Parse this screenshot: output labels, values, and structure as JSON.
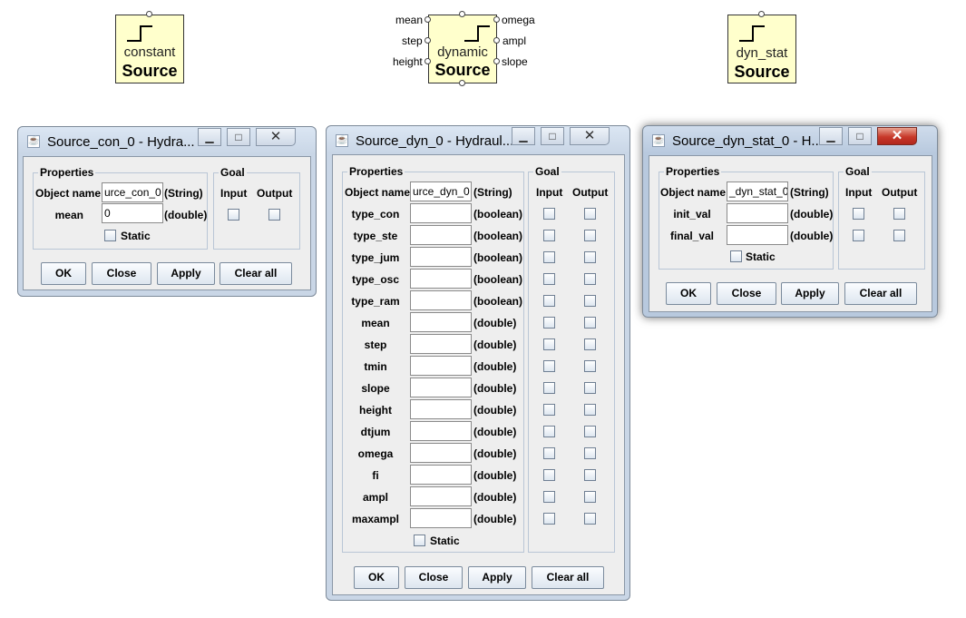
{
  "blocks": {
    "constant": {
      "sub": "constant",
      "main": "Source"
    },
    "dynamic": {
      "sub": "dynamic",
      "main": "Source",
      "ports_left": [
        "mean",
        "step",
        "height"
      ],
      "ports_right": [
        "omega",
        "ampl",
        "slope"
      ]
    },
    "dyn_stat": {
      "sub": "dyn_stat",
      "main": "Source"
    }
  },
  "win_con": {
    "title": "Source_con_0 - Hydra...",
    "properties_legend": "Properties",
    "goal_legend": "Goal",
    "input_header": "Input",
    "output_header": "Output",
    "object_name_label": "Object name",
    "object_name_value": "urce_con_0",
    "object_name_type": "(String)",
    "mean_label": "mean",
    "mean_value": "0",
    "mean_type": "(double)",
    "static_label": "Static",
    "buttons": {
      "ok": "OK",
      "close": "Close",
      "apply": "Apply",
      "clear": "Clear all"
    }
  },
  "win_dyn": {
    "title": "Source_dyn_0 - Hydraul...",
    "properties_legend": "Properties",
    "goal_legend": "Goal",
    "input_header": "Input",
    "output_header": "Output",
    "object_name_label": "Object name",
    "object_name_value": "urce_dyn_0",
    "object_name_type": "(String)",
    "rows": [
      {
        "label": "type_con",
        "type": "(boolean)"
      },
      {
        "label": "type_ste",
        "type": "(boolean)"
      },
      {
        "label": "type_jum",
        "type": "(boolean)"
      },
      {
        "label": "type_osc",
        "type": "(boolean)"
      },
      {
        "label": "type_ram",
        "type": "(boolean)"
      },
      {
        "label": "mean",
        "type": "(double)"
      },
      {
        "label": "step",
        "type": "(double)"
      },
      {
        "label": "tmin",
        "type": "(double)"
      },
      {
        "label": "slope",
        "type": "(double)"
      },
      {
        "label": "height",
        "type": "(double)"
      },
      {
        "label": "dtjum",
        "type": "(double)"
      },
      {
        "label": "omega",
        "type": "(double)"
      },
      {
        "label": "fi",
        "type": "(double)"
      },
      {
        "label": "ampl",
        "type": "(double)"
      },
      {
        "label": "maxampl",
        "type": "(double)"
      }
    ],
    "static_label": "Static",
    "buttons": {
      "ok": "OK",
      "close": "Close",
      "apply": "Apply",
      "clear": "Clear all"
    }
  },
  "win_stat": {
    "title": "Source_dyn_stat_0 - H...",
    "properties_legend": "Properties",
    "goal_legend": "Goal",
    "input_header": "Input",
    "output_header": "Output",
    "object_name_label": "Object name",
    "object_name_value": "_dyn_stat_0",
    "object_name_type": "(String)",
    "rows": [
      {
        "label": "init_val",
        "type": "(double)"
      },
      {
        "label": "final_val",
        "type": "(double)"
      }
    ],
    "static_label": "Static",
    "buttons": {
      "ok": "OK",
      "close": "Close",
      "apply": "Apply",
      "clear": "Clear all"
    }
  },
  "colors": {
    "block_fill": "#ffffcc",
    "client_bg": "#eeeeee",
    "close_red": "#c7382a"
  }
}
